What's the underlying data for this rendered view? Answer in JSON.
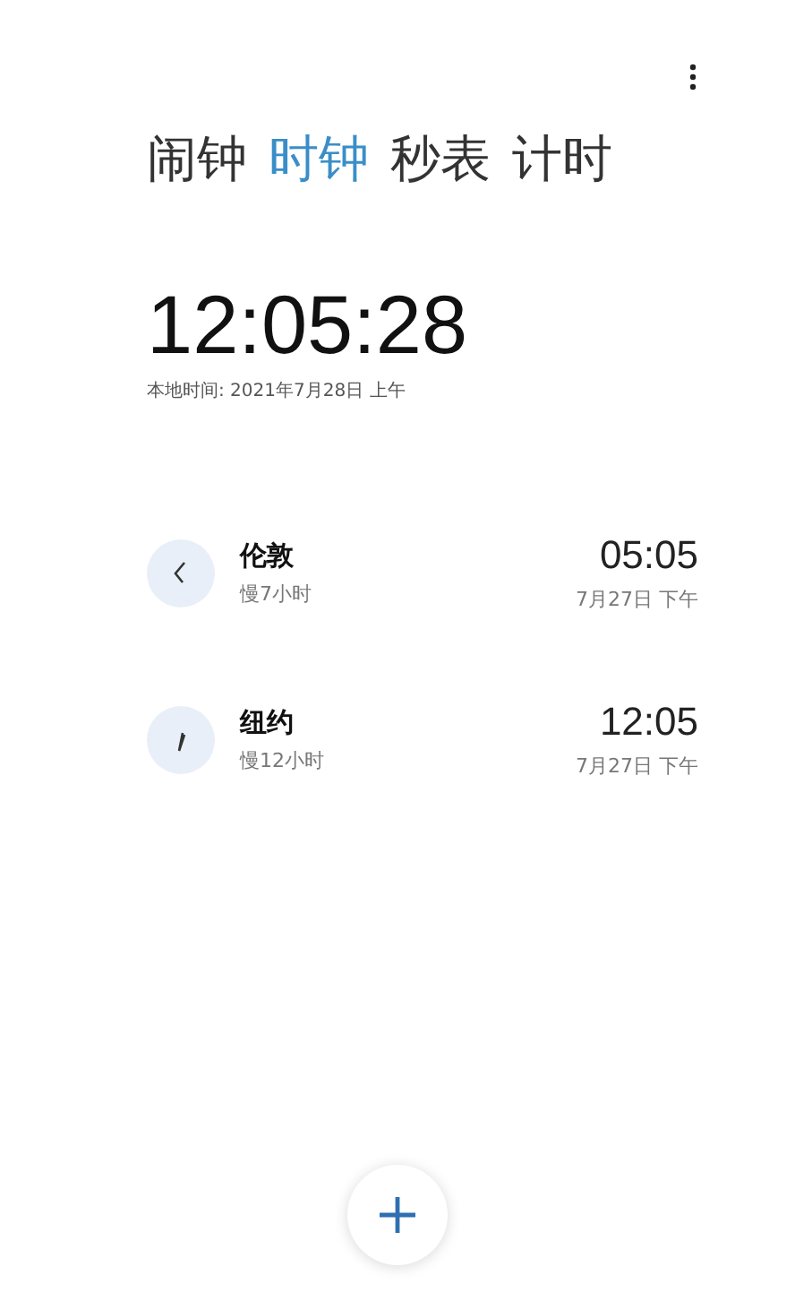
{
  "tabs": [
    {
      "label": "闹钟",
      "selected": false
    },
    {
      "label": "时钟",
      "selected": true
    },
    {
      "label": "秒表",
      "selected": false
    },
    {
      "label": "计时",
      "selected": false
    }
  ],
  "clock": {
    "time": "12:05:28",
    "local_date": "本地时间: 2021年7月28日 上午"
  },
  "cities": [
    {
      "name": "伦敦",
      "offset": "慢7小时",
      "time": "05:05",
      "date": "7月27日 下午"
    },
    {
      "name": "纽约",
      "offset": "慢12小时",
      "time": "12:05",
      "date": "7月27日 下午"
    }
  ]
}
